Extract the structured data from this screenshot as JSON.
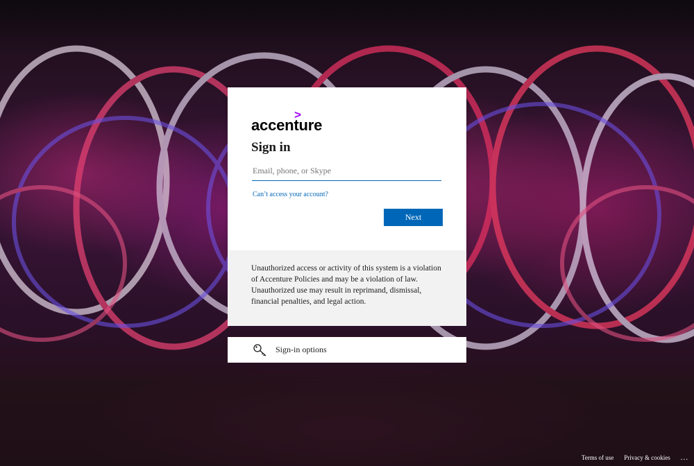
{
  "brand": {
    "logo_text": "accenture",
    "logo_mark": ">"
  },
  "signin": {
    "title": "Sign in",
    "input_placeholder": "Email, phone, or Skype",
    "input_value": "",
    "cant_access_link": "Can’t access your account?",
    "next_label": "Next"
  },
  "notice": {
    "text": "Unauthorized access or activity of this system is a violation of Accenture Policies and may be a violation of law. Unauthorized use may result in reprimand, dismissal, financial penalties, and legal action."
  },
  "options": {
    "label": "Sign-in options",
    "icon": "key-icon"
  },
  "footer": {
    "terms": "Terms of use",
    "privacy": "Privacy & cookies",
    "more": "..."
  },
  "colors": {
    "accent": "#0067b8",
    "brand_purple": "#a100ff"
  }
}
